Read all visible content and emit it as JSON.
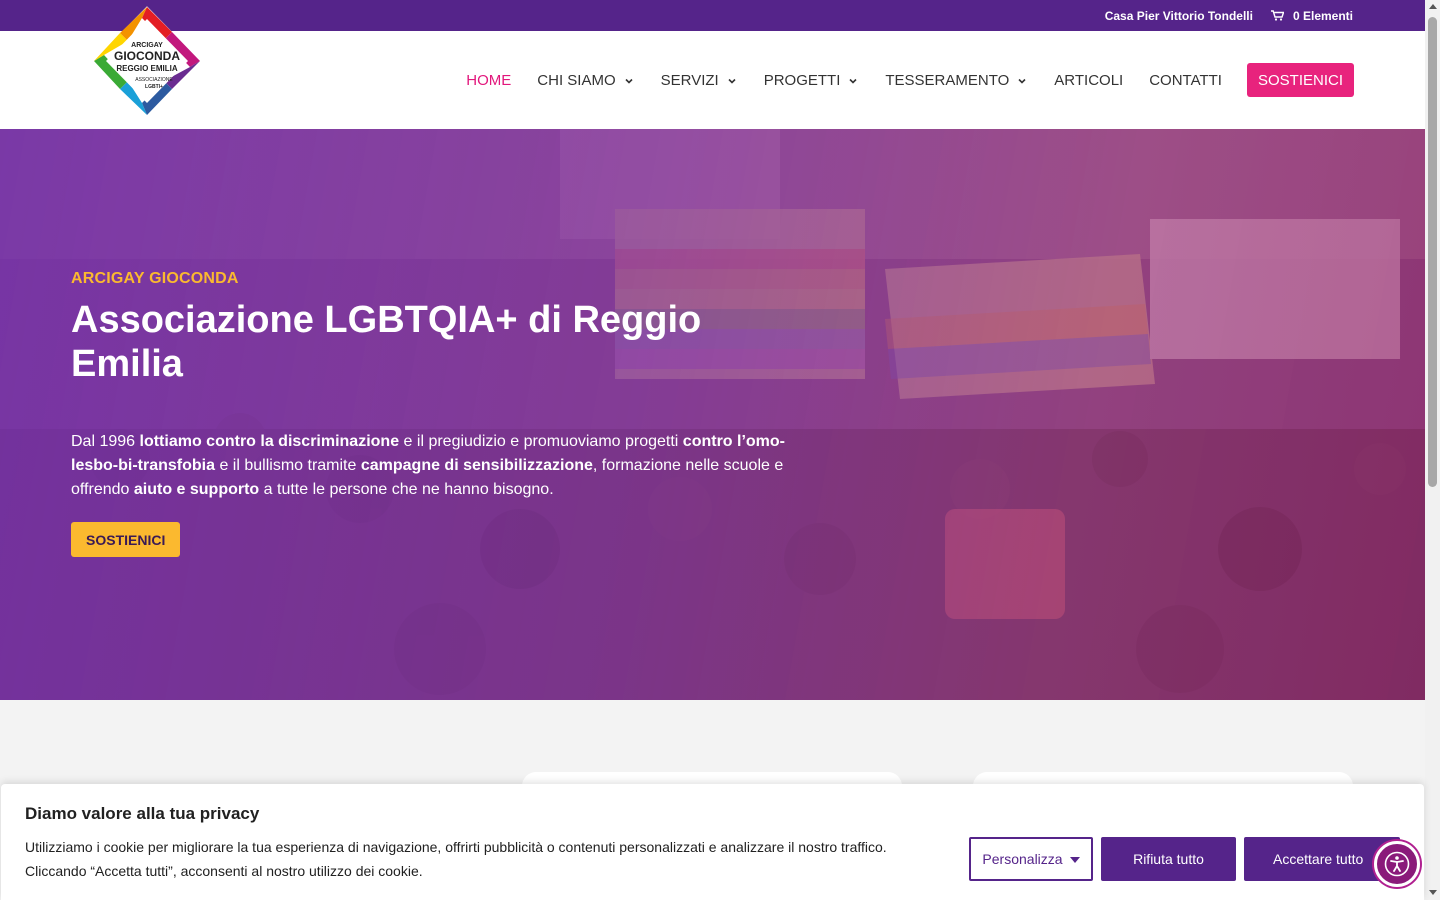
{
  "topbar": {
    "location_link": "Casa Pier Vittorio Tondelli",
    "cart_label": "0 Elementi",
    "cart_icon": "cart-icon"
  },
  "logo": {
    "line1": "ARCIGAY",
    "line2": "GIOCONDA",
    "line3": "REGGIO EMILIA",
    "line4": "ASSOCIAZIONE",
    "line5": "LGBTI+"
  },
  "nav": {
    "items": [
      {
        "label": "HOME",
        "active": true,
        "dropdown": false
      },
      {
        "label": "CHI SIAMO",
        "active": false,
        "dropdown": true
      },
      {
        "label": "SERVIZI",
        "active": false,
        "dropdown": true
      },
      {
        "label": "PROGETTI",
        "active": false,
        "dropdown": true
      },
      {
        "label": "TESSERAMENTO",
        "active": false,
        "dropdown": true
      },
      {
        "label": "ARTICOLI",
        "active": false,
        "dropdown": false
      },
      {
        "label": "CONTATTI",
        "active": false,
        "dropdown": false
      }
    ],
    "cta": "SOSTIENICI"
  },
  "hero": {
    "eyebrow": "ARCIGAY GIOCONDA",
    "title": "Associazione LGBTQIA+ di Reggio Emilia",
    "description": {
      "t1": "Dal 1996 ",
      "b1": "lottiamo contro la discriminazione",
      "t2": " e il pregiudizio e promuoviamo progetti ",
      "b2": "contro l’omo-lesbo-bi-transfobia",
      "t3": " e il bullismo tramite ",
      "b3": "campagne di sensibilizzazione",
      "t4": ", formazione nelle scuole e offrendo ",
      "b4": "aiuto e supporto",
      "t5": " a tutte le persone che ne hanno bisogno."
    },
    "button": "SOSTIENICI"
  },
  "cookie": {
    "title": "Diamo valore alla tua privacy",
    "text": "Utilizziamo i cookie per migliorare la tua esperienza di navigazione, offrirti pubblicità o contenuti personalizzati e analizzare il nostro traffico. Cliccando “Accetta tutti”, acconsenti al nostro utilizzo dei cookie.",
    "customize": "Personalizza",
    "reject": "Rifiuta tutto",
    "accept": "Accettare tutto"
  },
  "colors": {
    "brand_purple": "#55248a",
    "accent_pink": "#e8237d",
    "accent_yellow": "#fbb92f"
  }
}
